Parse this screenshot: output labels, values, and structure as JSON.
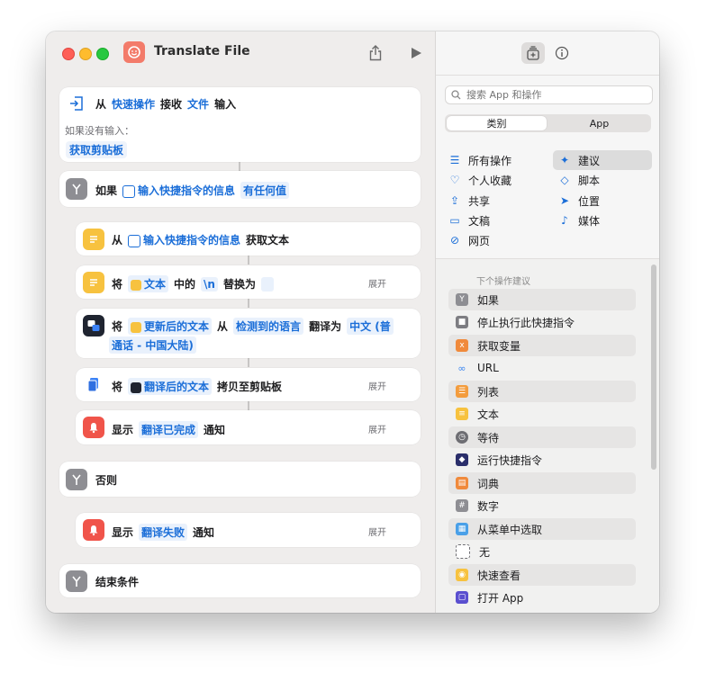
{
  "window": {
    "title": "Translate File"
  },
  "workflow": {
    "receive": {
      "from": "从",
      "source": "快速操作",
      "receive": "接收",
      "type": "文件",
      "input": "输入",
      "no_input_label": "如果没有输入：",
      "fallback": "获取剪贴板"
    },
    "if_block": {
      "kw": "如果",
      "var": "输入快捷指令的信息",
      "cond": "有任何值"
    },
    "get_text": {
      "from": "从",
      "var": "输入快捷指令的信息",
      "action": "获取文本"
    },
    "replace": {
      "kw": "将",
      "var": "文本",
      "in": "中的",
      "pattern": "\\n",
      "action": "替换为",
      "expand": "展开"
    },
    "translate": {
      "kw": "将",
      "var": "更新后的文本",
      "from": "从",
      "detect": "检测到的语言",
      "to_kw": "翻译为",
      "lang_line1": "中文 (普",
      "lang_line2": "通话 - 中国大陆)"
    },
    "copy": {
      "kw": "将",
      "var": "翻译后的文本",
      "action": "拷贝至剪贴板",
      "expand": "展开"
    },
    "notify_ok": {
      "kw": "显示",
      "msg": "翻译已完成",
      "action": "通知",
      "expand": "展开"
    },
    "otherwise": "否则",
    "notify_fail": {
      "kw": "显示",
      "msg": "翻译失败",
      "action": "通知",
      "expand": "展开"
    },
    "end_if": "结束条件"
  },
  "sidebar": {
    "search_placeholder": "搜索 App 和操作",
    "segments": [
      "类别",
      "App"
    ],
    "categories": [
      {
        "label": "所有操作",
        "icon": "list-icon"
      },
      {
        "label": "建议",
        "icon": "sparkle-icon",
        "selected": true
      },
      {
        "label": "个人收藏",
        "icon": "heart-icon"
      },
      {
        "label": "脚本",
        "icon": "script-icon"
      },
      {
        "label": "共享",
        "icon": "share-icon"
      },
      {
        "label": "位置",
        "icon": "location-icon"
      },
      {
        "label": "文稿",
        "icon": "document-icon"
      },
      {
        "label": "媒体",
        "icon": "music-note-icon"
      },
      {
        "label": "网页",
        "icon": "compass-icon"
      }
    ],
    "suggestions_title": "下个操作建议",
    "suggestions": [
      {
        "label": "如果",
        "color": "#8e8e93"
      },
      {
        "label": "停止执行此快捷指令",
        "color": "#7d7d82"
      },
      {
        "label": "获取变量",
        "color": "#f08a3c"
      },
      {
        "label": "URL",
        "color": "#3a86f0"
      },
      {
        "label": "列表",
        "color": "#f39c3d"
      },
      {
        "label": "文本",
        "color": "#f7c23f"
      },
      {
        "label": "等待",
        "color": "#6e6e73"
      },
      {
        "label": "运行快捷指令",
        "color": "#2b2f6b"
      },
      {
        "label": "词典",
        "color": "#f08a3c"
      },
      {
        "label": "数字",
        "color": "#8e8e93"
      },
      {
        "label": "从菜单中选取",
        "color": "#4aa0e8"
      },
      {
        "label": "无",
        "color": "#ffffff"
      },
      {
        "label": "快速查看",
        "color": "#f7c23f"
      },
      {
        "label": "打开 App",
        "color": "#5a4fcf"
      }
    ]
  },
  "colors": {
    "accent": "#1b6ed8",
    "window_bg": "#efedec"
  }
}
